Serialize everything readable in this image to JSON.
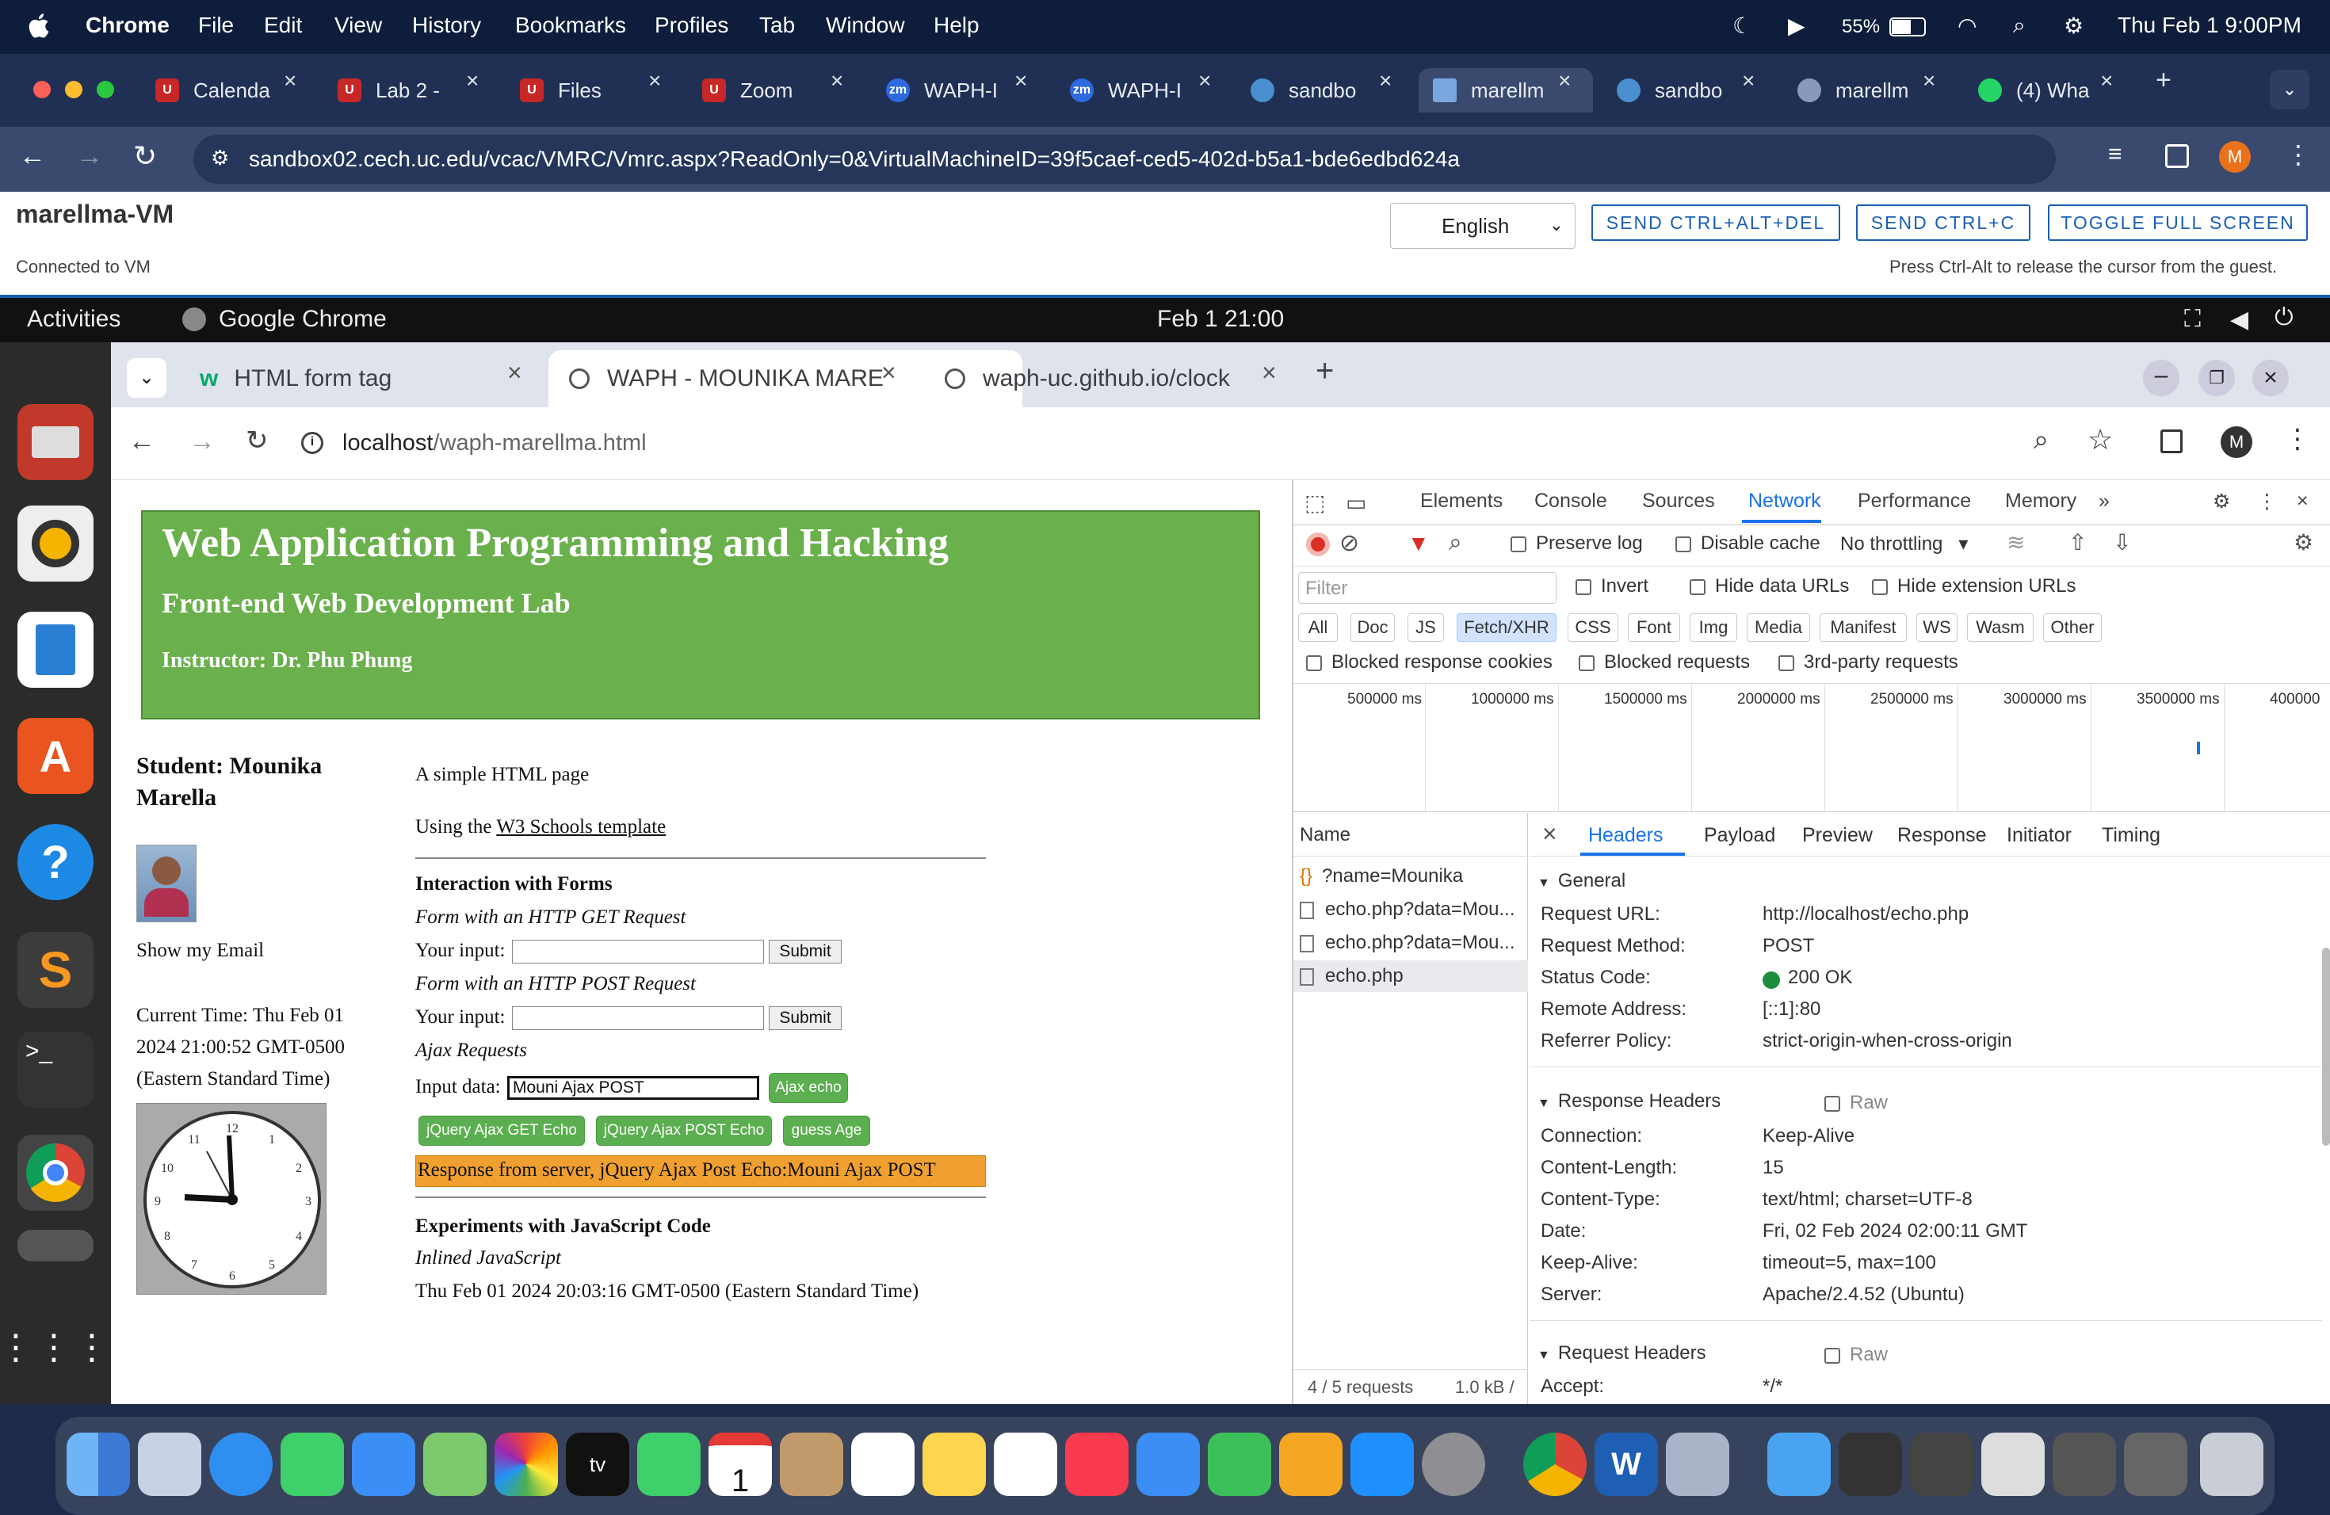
{
  "menubar": {
    "app": "Chrome",
    "items": [
      "File",
      "Edit",
      "View",
      "History",
      "Bookmarks",
      "Profiles",
      "Tab",
      "Window",
      "Help"
    ],
    "battery": "55%",
    "datetime": "Thu Feb 1  9:00PM"
  },
  "outer_tabs": [
    "Calenda",
    "Lab 2 -",
    "Files",
    "Zoom",
    "WAPH-I",
    "WAPH-I",
    "sandbo",
    "marellm",
    "sandbo",
    "marellm",
    "(4) Wha"
  ],
  "outer_url": "sandbox02.cech.uc.edu/vcac/VMRC/Vmrc.aspx?ReadOnly=0&VirtualMachineID=39f5caef-ced5-402d-b5a1-bde6edbd624a",
  "vm": {
    "name": "marellma-VM",
    "status": "Connected to VM",
    "lang": "English",
    "btn_cad": "SEND CTRL+ALT+DEL",
    "btn_cc": "SEND CTRL+C",
    "btn_fs": "TOGGLE FULL SCREEN",
    "hint": "Press Ctrl-Alt to release the cursor from the guest."
  },
  "ubuntu": {
    "activities": "Activities",
    "app": "Google Chrome",
    "clock": "Feb 1  21:00"
  },
  "inner_tabs": [
    "HTML form tag",
    "WAPH - MOUNIKA MARE",
    "waph-uc.github.io/clock"
  ],
  "inner_url": {
    "host": "localhost",
    "path": "/waph-marellma.html"
  },
  "page": {
    "title": "Web Application Programming and Hacking",
    "subtitle": "Front-end Web Development Lab",
    "instructor": "Instructor: Dr. Phu Phung",
    "student1": "Student: Mounika",
    "student2": "Marella",
    "show_email": "Show my Email",
    "time1": "Current Time: Thu Feb 01",
    "time2": "2024 21:00:52 GMT-0500",
    "time3": "(Eastern Standard Time)",
    "simple": "A simple HTML page",
    "using": "Using the ",
    "w3": "W3 Schools template",
    "forms_h": "Interaction with Forms",
    "get_h": "Form with an HTTP GET Request",
    "your_input": "Your input:",
    "submit": "Submit",
    "post_h": "Form with an HTTP POST Request",
    "ajax_h": "Ajax Requests",
    "input_data": "Input data:",
    "input_val": "Mouni Ajax POST",
    "ajax_echo": "Ajax echo",
    "jq_get": "jQuery Ajax GET Echo",
    "jq_post": "jQuery Ajax POST Echo",
    "guess_age": "guess Age",
    "response": "Response from server, jQuery Ajax Post Echo:Mouni Ajax POST",
    "exp_h": "Experiments with JavaScript Code",
    "inlined": "Inlined JavaScript",
    "inlined_time": "Thu Feb 01 2024 20:03:16 GMT-0500 (Eastern Standard Time)"
  },
  "devtools": {
    "tabs": [
      "Elements",
      "Console",
      "Sources",
      "Network",
      "Performance",
      "Memory"
    ],
    "preserve": "Preserve log",
    "disable": "Disable cache",
    "throttle": "No throttling",
    "filter": "Filter",
    "invert": "Invert",
    "hide_data": "Hide data URLs",
    "hide_ext": "Hide extension URLs",
    "chips": [
      "All",
      "Doc",
      "JS",
      "Fetch/XHR",
      "CSS",
      "Font",
      "Img",
      "Media",
      "Manifest",
      "WS",
      "Wasm",
      "Other"
    ],
    "blocked_cookies": "Blocked response cookies",
    "blocked_req": "Blocked requests",
    "third": "3rd-party requests",
    "ticks": [
      "500000 ms",
      "1000000 ms",
      "1500000 ms",
      "2000000 ms",
      "2500000 ms",
      "3000000 ms",
      "3500000 ms",
      "400000"
    ],
    "name_col": "Name",
    "requests": [
      "?name=Mounika",
      "echo.php?data=Mou...",
      "echo.php?data=Mou...",
      "echo.php"
    ],
    "detail_tabs": [
      "Headers",
      "Payload",
      "Preview",
      "Response",
      "Initiator",
      "Timing"
    ],
    "general": "General",
    "gen_rows": [
      [
        "Request URL:",
        "http://localhost/echo.php"
      ],
      [
        "Request Method:",
        "POST"
      ],
      [
        "Status Code:",
        "200 OK"
      ],
      [
        "Remote Address:",
        "[::1]:80"
      ],
      [
        "Referrer Policy:",
        "strict-origin-when-cross-origin"
      ]
    ],
    "resp_h": "Response Headers",
    "raw": "Raw",
    "resp_rows": [
      [
        "Connection:",
        "Keep-Alive"
      ],
      [
        "Content-Length:",
        "15"
      ],
      [
        "Content-Type:",
        "text/html; charset=UTF-8"
      ],
      [
        "Date:",
        "Fri, 02 Feb 2024 02:00:11 GMT"
      ],
      [
        "Keep-Alive:",
        "timeout=5, max=100"
      ],
      [
        "Server:",
        "Apache/2.4.52 (Ubuntu)"
      ]
    ],
    "req_h": "Request Headers",
    "accept": [
      "Accept:",
      "*/*"
    ],
    "footer_req": "4 / 5 requests",
    "footer_kb": "1.0 kB /"
  },
  "colors": {
    "banner": "#6ab04c",
    "response_bg": "#f0a030",
    "devtools_accent": "#1a73e8"
  }
}
